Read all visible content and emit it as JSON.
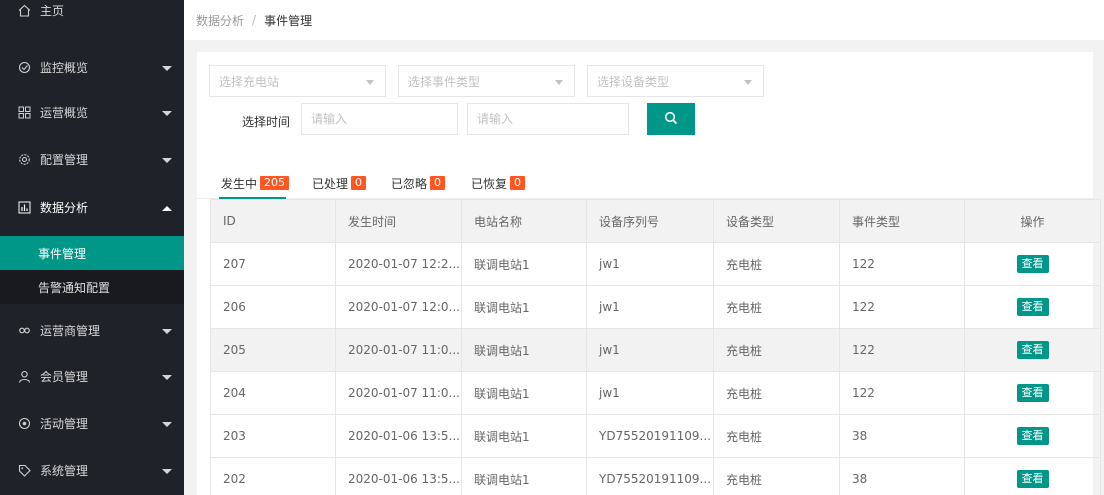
{
  "sidebar": {
    "home": "主页",
    "items": [
      {
        "label": "监控概览",
        "icon": "monitor-icon"
      },
      {
        "label": "运营概览",
        "icon": "grid-icon"
      },
      {
        "label": "配置管理",
        "icon": "gear-icon"
      },
      {
        "label": "数据分析",
        "icon": "chart-icon"
      },
      {
        "label": "运营商管理",
        "icon": "link-icon"
      },
      {
        "label": "会员管理",
        "icon": "user-icon"
      },
      {
        "label": "活动管理",
        "icon": "activity-icon"
      },
      {
        "label": "系统管理",
        "icon": "tag-icon"
      }
    ],
    "sub_items": [
      {
        "label": "事件管理"
      },
      {
        "label": "告警通知配置"
      }
    ]
  },
  "breadcrumb": {
    "parent": "数据分析",
    "separator": "/",
    "current": "事件管理"
  },
  "filters": {
    "station_placeholder": "选择充电站",
    "event_type_placeholder": "选择事件类型",
    "device_type_placeholder": "选择设备类型",
    "time_label": "选择时间",
    "start_placeholder": "请输入",
    "end_placeholder": "请输入"
  },
  "tabs": [
    {
      "label": "发生中",
      "count": "205"
    },
    {
      "label": "已处理",
      "count": "0"
    },
    {
      "label": "已忽略",
      "count": "0"
    },
    {
      "label": "已恢复",
      "count": "0"
    }
  ],
  "table": {
    "headers": [
      "ID",
      "发生时间",
      "电站名称",
      "设备序列号",
      "设备类型",
      "事件类型",
      "操作"
    ],
    "action_label": "查看",
    "rows": [
      {
        "id": "207",
        "time": "2020-01-07 12:2...",
        "station": "联调电站1",
        "serial": "jw1",
        "device_type": "充电桩",
        "event_type": "122"
      },
      {
        "id": "206",
        "time": "2020-01-07 12:0...",
        "station": "联调电站1",
        "serial": "jw1",
        "device_type": "充电桩",
        "event_type": "122"
      },
      {
        "id": "205",
        "time": "2020-01-07 11:0...",
        "station": "联调电站1",
        "serial": "jw1",
        "device_type": "充电桩",
        "event_type": "122"
      },
      {
        "id": "204",
        "time": "2020-01-07 11:0...",
        "station": "联调电站1",
        "serial": "jw1",
        "device_type": "充电桩",
        "event_type": "122"
      },
      {
        "id": "203",
        "time": "2020-01-06 13:5...",
        "station": "联调电站1",
        "serial": "YD75520191109...",
        "device_type": "充电桩",
        "event_type": "38"
      },
      {
        "id": "202",
        "time": "2020-01-06 13:5...",
        "station": "联调电站1",
        "serial": "YD75520191109...",
        "device_type": "充电桩",
        "event_type": "38"
      }
    ]
  },
  "colors": {
    "accent": "#009688",
    "badge": "#ff5722",
    "sidebar_bg": "#20222a"
  }
}
